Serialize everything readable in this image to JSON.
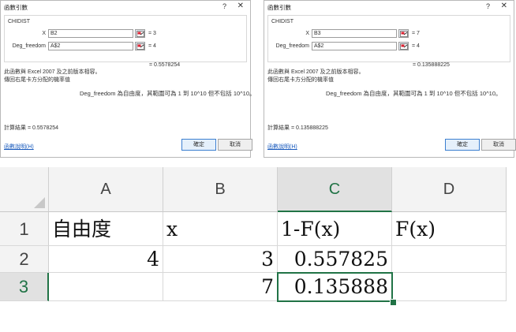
{
  "dialogs": [
    {
      "title": "函數引數",
      "help_glyph": "?",
      "close_glyph": "✕",
      "function_name": "CHIDIST",
      "args": [
        {
          "label": "X",
          "input": "B2",
          "value": "= 3"
        },
        {
          "label": "Deg_freedom",
          "input": "A$2",
          "value": "= 4"
        }
      ],
      "result": "= 0.5578254",
      "description_line1": "此函數與 Excel 2007 及之前版本相容。",
      "description_line2": "傳回右尾卡方分配的機率值",
      "arg_description": "Deg_freedom  為自由度，其範圍可為 1 到 10^10 但不包括 10^10。",
      "calc_result": "計算結果 =  0.5578254",
      "help_link": "函數說明(H)",
      "ok_label": "確定",
      "cancel_label": "取消"
    },
    {
      "title": "函數引數",
      "help_glyph": "?",
      "close_glyph": "✕",
      "function_name": "CHIDIST",
      "args": [
        {
          "label": "X",
          "input": "B3",
          "value": "= 7"
        },
        {
          "label": "Deg_freedom",
          "input": "A$2",
          "value": "= 4"
        }
      ],
      "result": "= 0.135888225",
      "description_line1": "此函數與 Excel 2007 及之前版本相容。",
      "description_line2": "傳回右尾卡方分配的機率值",
      "arg_description": "Deg_freedom  為自由度，其範圍可為 1 到 10^10 但不包括 10^10。",
      "calc_result": "計算結果 =  0.135888225",
      "help_link": "函數說明(H)",
      "ok_label": "確定",
      "cancel_label": "取消"
    }
  ],
  "sheet": {
    "columns": [
      "A",
      "B",
      "C",
      "D"
    ],
    "rows": [
      "1",
      "2",
      "3"
    ],
    "cells": {
      "A1": "自由度",
      "B1": "x",
      "C1": "1-F(x)",
      "D1": "F(x)",
      "A2": "4",
      "B2": "3",
      "C2": "0.557825",
      "D2": "",
      "A3": "",
      "B3": "7",
      "C3": "0.135888",
      "D3": ""
    },
    "selected_cell": "C3",
    "accent_color": "#217346"
  },
  "icons": {
    "range_picker": "range-select-icon"
  }
}
